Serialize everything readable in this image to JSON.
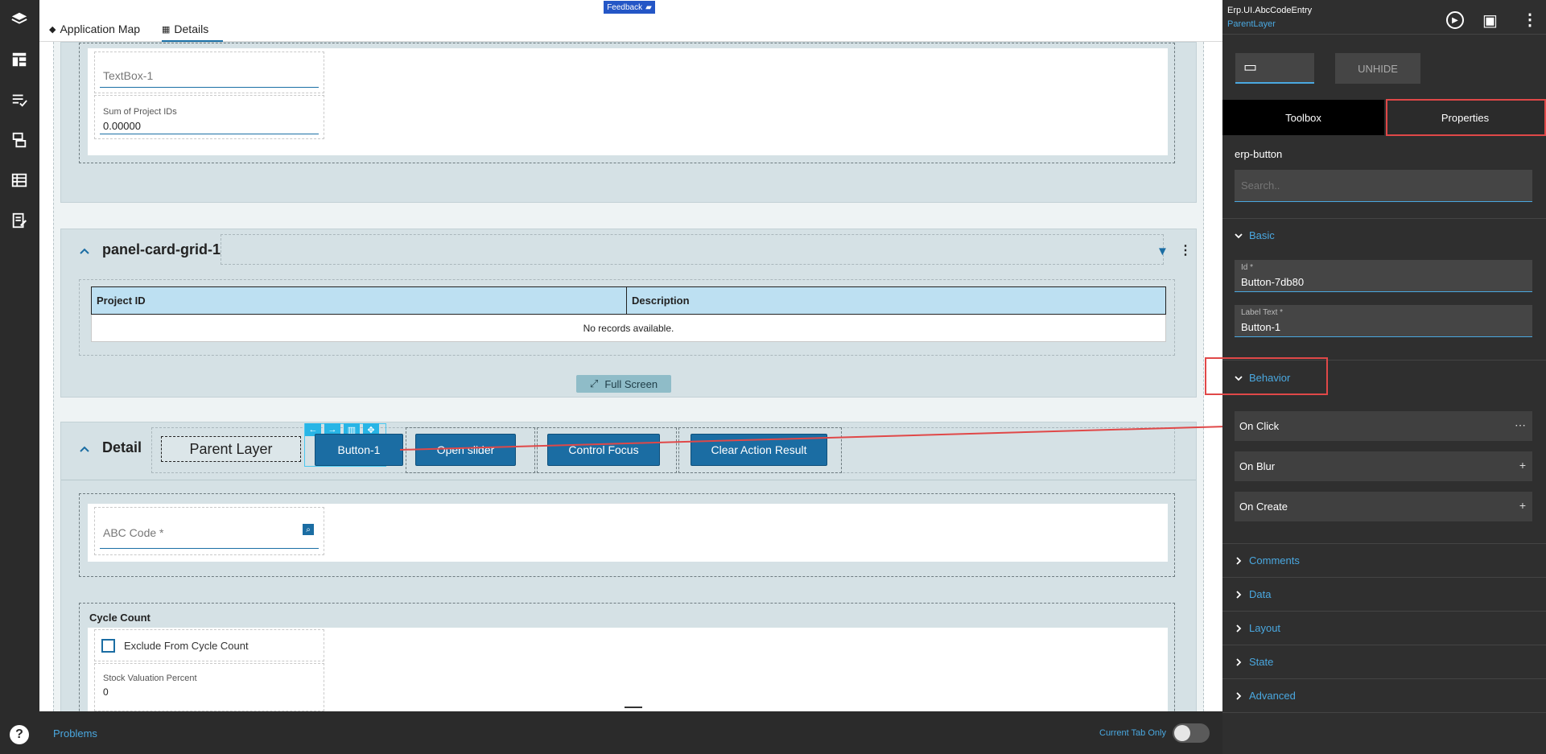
{
  "rail": {
    "items": [
      "layers",
      "layout",
      "checklist",
      "pages",
      "table",
      "form"
    ],
    "help": "?"
  },
  "topbar": {
    "tabs": [
      {
        "label": "Application Map",
        "icon": "layers-icon"
      },
      {
        "label": "Details",
        "icon": "grid-icon"
      }
    ],
    "feedback": "Feedback"
  },
  "top_section": {
    "textbox_placeholder": "TextBox-1",
    "sum_label": "Sum of Project IDs",
    "sum_value": "0.00000"
  },
  "grid_panel": {
    "title": "panel-card-grid-1",
    "columns": [
      "Project ID",
      "Description"
    ],
    "empty_text": "No records available.",
    "full_screen": "Full Screen"
  },
  "detail_panel": {
    "title": "Detail",
    "parent_layer": "Parent Layer",
    "buttons": [
      "Button-1",
      "Open slider",
      "Control Focus",
      "Clear Action Result"
    ],
    "abc_placeholder": "ABC Code *",
    "cycle_count_title": "Cycle Count",
    "exclude_label": "Exclude From Cycle Count",
    "stock_label": "Stock Valuation Percent",
    "stock_value": "0"
  },
  "bottombar": {
    "problems": "Problems",
    "current_tab_only": "Current Tab Only"
  },
  "right_panel": {
    "app_name": "Erp.UI.AbcCodeEntry",
    "layer": "ParentLayer",
    "unhide": "UNHIDE",
    "tabs": [
      "Toolbox",
      "Properties"
    ],
    "component": "erp-button",
    "search_placeholder": "Search..",
    "basic": "Basic",
    "id_label": "Id *",
    "id_value": "Button-7db80",
    "label_text_label": "Label Text *",
    "label_text_value": "Button-1",
    "behavior": "Behavior",
    "events": [
      {
        "label": "On Click",
        "action": "⋯"
      },
      {
        "label": "On Blur",
        "action": "+"
      },
      {
        "label": "On Create",
        "action": "+"
      }
    ],
    "sections": [
      "Comments",
      "Data",
      "Layout",
      "State",
      "Advanced"
    ]
  },
  "colors": {
    "accent": "#1b6da3",
    "link": "#4aa8e0",
    "highlight": "#e04848",
    "dark_bg": "#2f2f2f"
  }
}
